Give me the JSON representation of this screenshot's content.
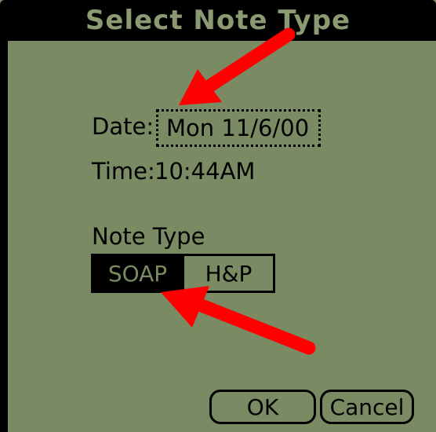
{
  "window": {
    "title": "Select Note Type"
  },
  "form": {
    "date_label": "Date:",
    "date_value": "Mon 11/6/00",
    "time_label": "Time:",
    "time_value": "10:44AM",
    "note_type_label": "Note Type"
  },
  "note_type": {
    "options": [
      "SOAP",
      "H&P"
    ],
    "selected": "SOAP"
  },
  "buttons": {
    "ok": "OK",
    "cancel": "Cancel"
  },
  "colors": {
    "screen": "#7a8a62",
    "title_bar": "#000000",
    "title_text": "#8c9a73",
    "annotation_arrow": "#ff0000"
  }
}
